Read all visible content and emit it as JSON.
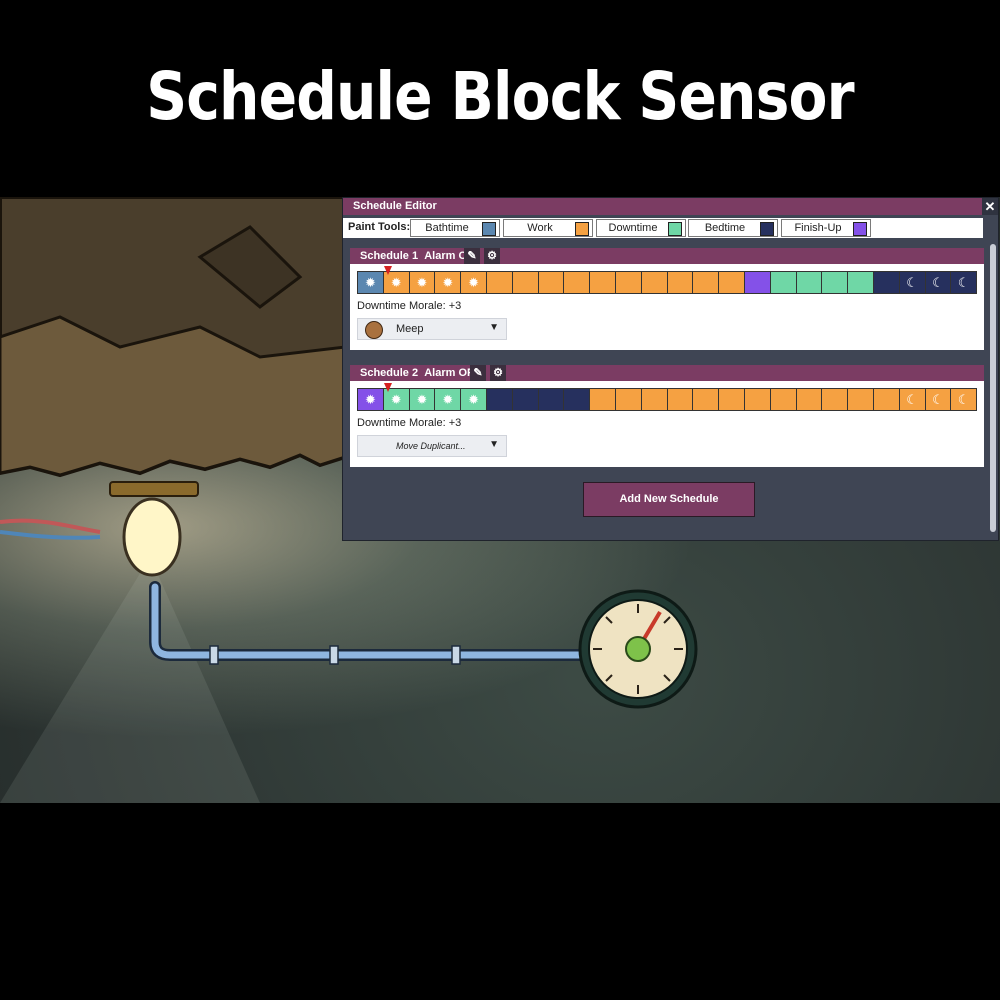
{
  "title": "Schedule Block Sensor",
  "editor": {
    "title": "Schedule Editor",
    "close_label": "✕",
    "paint_label": "Paint Tools:",
    "tools": [
      {
        "label": "Bathtime",
        "color": "#5b87b0"
      },
      {
        "label": "Work",
        "color": "#f5a142"
      },
      {
        "label": "Downtime",
        "color": "#6fd7a6"
      },
      {
        "label": "Bedtime",
        "color": "#26305e"
      },
      {
        "label": "Finish-Up",
        "color": "#8451e8"
      }
    ],
    "schedules": [
      {
        "name": "Schedule 1",
        "alarm": "Alarm On",
        "morale": "Downtime Morale: +3",
        "assignee": "Meep",
        "blocks": [
          "bath",
          "work",
          "work",
          "work",
          "work",
          "work",
          "work",
          "work",
          "work",
          "work",
          "work",
          "work",
          "work",
          "work",
          "work",
          "finish",
          "down",
          "down",
          "down",
          "down",
          "bed",
          "bed",
          "bed",
          "bed"
        ],
        "current_block": 1
      },
      {
        "name": "Schedule 2",
        "alarm": "Alarm OFF",
        "morale": "Downtime Morale: +3",
        "assignee": "Move Duplicant...",
        "blocks": [
          "finish",
          "down",
          "down",
          "down",
          "down",
          "bed",
          "bed",
          "bed",
          "bed",
          "work",
          "work",
          "work",
          "work",
          "work",
          "work",
          "work",
          "work",
          "work",
          "work",
          "work",
          "work",
          "work",
          "work",
          "work"
        ],
        "current_block": 1
      }
    ],
    "add_button": "Add New Schedule"
  }
}
